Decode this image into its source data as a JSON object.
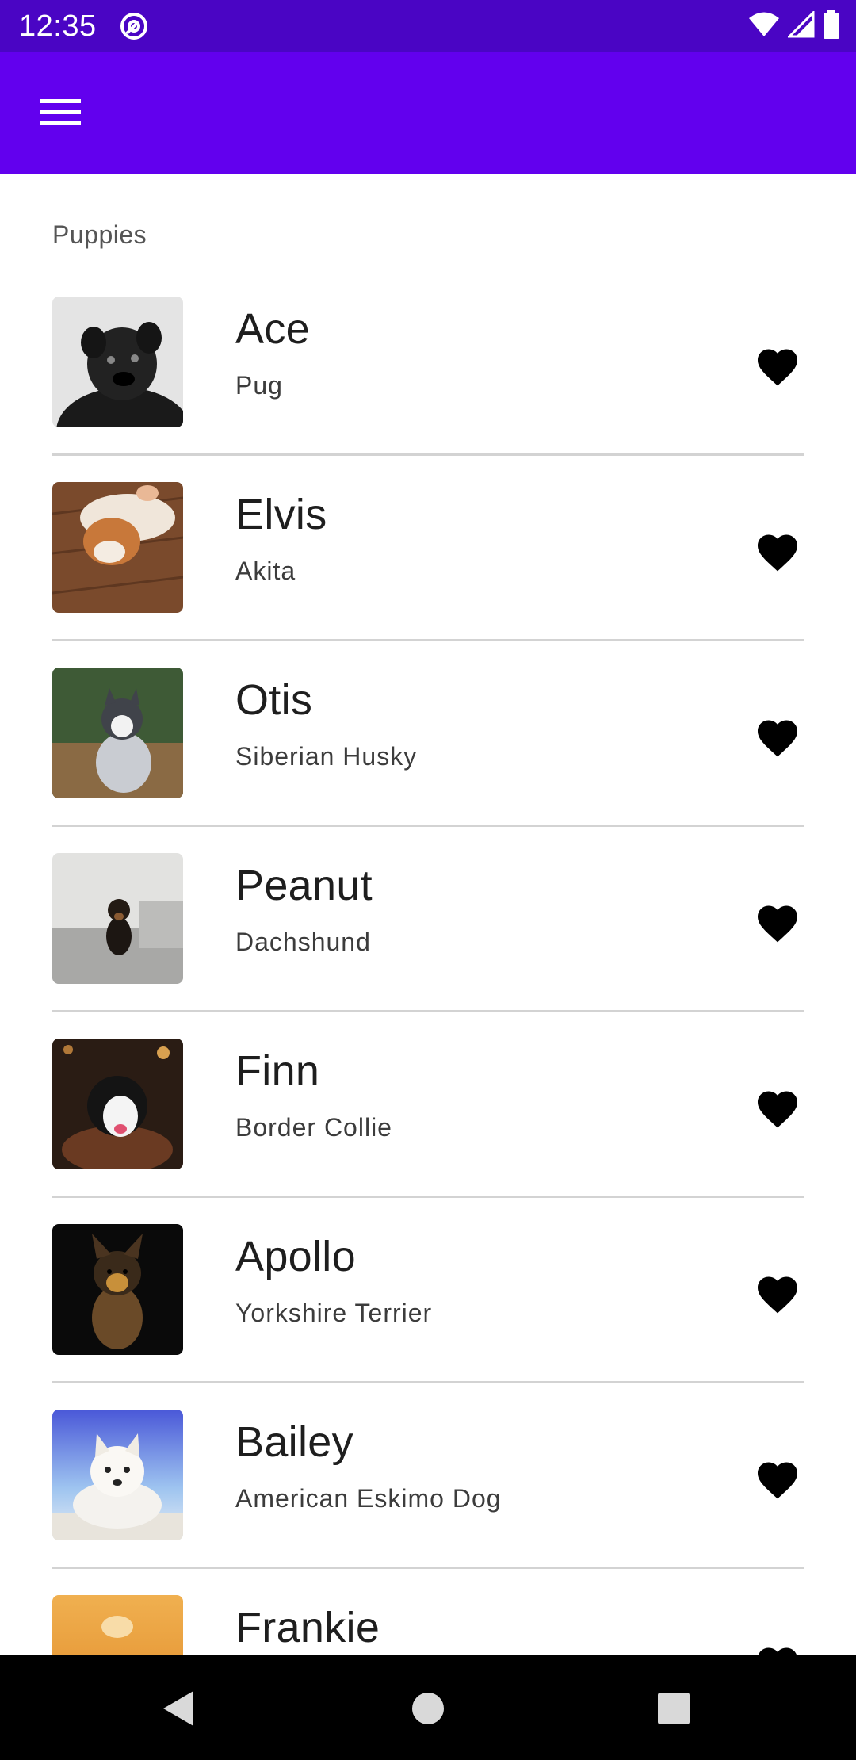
{
  "status_bar": {
    "time": "12:35",
    "icons": [
      "at-sign-icon",
      "wifi-icon",
      "signal-icon",
      "battery-icon"
    ]
  },
  "app_bar": {
    "menu_icon": "hamburger-menu-icon",
    "background": "#6200ee",
    "status_background": "#4a05c4"
  },
  "section": {
    "label": "Puppies"
  },
  "puppies": [
    {
      "name": "Ace",
      "breed": "Pug",
      "favorite_icon": "heart-icon"
    },
    {
      "name": "Elvis",
      "breed": "Akita",
      "favorite_icon": "heart-icon"
    },
    {
      "name": "Otis",
      "breed": "Siberian Husky",
      "favorite_icon": "heart-icon"
    },
    {
      "name": "Peanut",
      "breed": "Dachshund",
      "favorite_icon": "heart-icon"
    },
    {
      "name": "Finn",
      "breed": "Border Collie",
      "favorite_icon": "heart-icon"
    },
    {
      "name": "Apollo",
      "breed": "Yorkshire Terrier",
      "favorite_icon": "heart-icon"
    },
    {
      "name": "Bailey",
      "breed": "American Eskimo Dog",
      "favorite_icon": "heart-icon"
    },
    {
      "name": "Frankie",
      "breed": "",
      "favorite_icon": "heart-icon"
    }
  ],
  "nav_bar": {
    "back_icon": "back-triangle-icon",
    "home_icon": "home-circle-icon",
    "recents_icon": "recents-square-icon"
  }
}
